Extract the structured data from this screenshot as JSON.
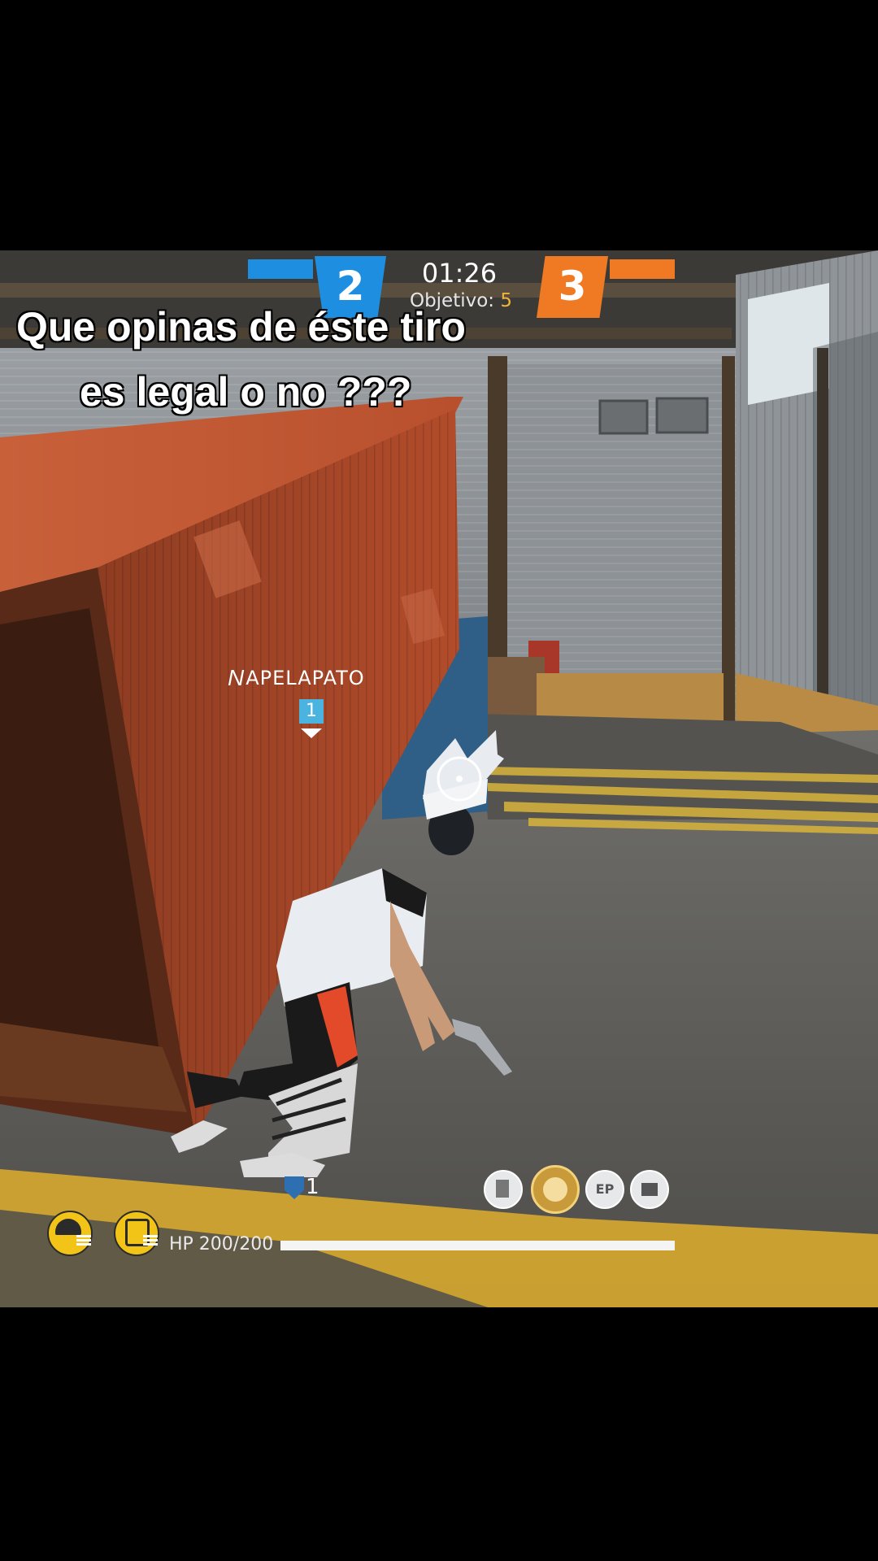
{
  "caption": {
    "line1": "Que opinas de éste tiro",
    "line2": "es legal o no ???"
  },
  "scoreboard": {
    "blue_score": "2",
    "orange_score": "3",
    "timer": "01:26",
    "objective_label": "Objetivo:",
    "objective_value": "5",
    "colors": {
      "blue": "#1e8fe0",
      "orange": "#f07a23",
      "objective": "#f0b43a"
    }
  },
  "teammate": {
    "name": "APELAPATO",
    "marker": "1"
  },
  "player": {
    "squad_number": "1"
  },
  "status": {
    "hp_label": "HP 200/200",
    "hp_fraction": 1.0
  },
  "icons": {
    "helmet": "helmet-icon",
    "vest": "vest-icon",
    "item_slots": [
      "gloo-wall-icon",
      "character-skill-icon",
      "ep-icon",
      "medkit-icon"
    ],
    "ep_label": "EP"
  }
}
